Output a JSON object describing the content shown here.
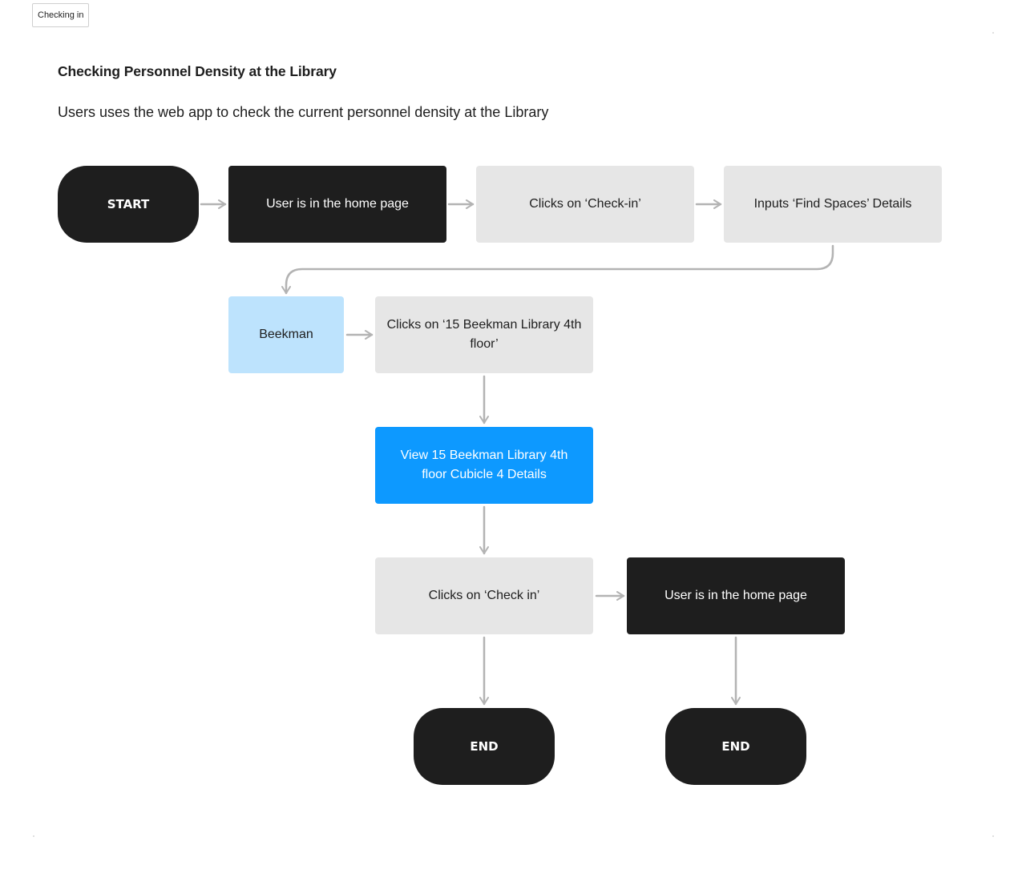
{
  "frame": {
    "label": "Checking in"
  },
  "header": {
    "title": "Checking Personnel Density at the Library",
    "subtitle": "Users uses the web app to check the current personnel density at the Library"
  },
  "colors": {
    "terminal": "#1e1e1e",
    "dark_step": "#1e1e1e",
    "gray_step": "#e6e6e6",
    "light_blue_step": "#bde3fd",
    "blue_step": "#0d99ff",
    "connector": "#b3b3b3"
  },
  "flow": {
    "nodes": [
      {
        "id": "start",
        "label": "START",
        "style": "terminal"
      },
      {
        "id": "home1",
        "label": "User is in the home page",
        "style": "dark"
      },
      {
        "id": "checkin1",
        "label": "Clicks on ‘Check-in’",
        "style": "gray"
      },
      {
        "id": "find",
        "label": "Inputs  ‘Find Spaces’ Details",
        "style": "gray"
      },
      {
        "id": "beekman",
        "label": "Beekman",
        "style": "light-blue"
      },
      {
        "id": "floor",
        "label": "Clicks on ‘15 Beekman Library 4th floor’",
        "style": "gray"
      },
      {
        "id": "view",
        "label": "View 15 Beekman Library 4th floor Cubicle 4 Details",
        "style": "blue"
      },
      {
        "id": "checkin2",
        "label": "Clicks on ‘Check in’",
        "style": "gray"
      },
      {
        "id": "home2",
        "label": "User is in the home page",
        "style": "dark"
      },
      {
        "id": "end1",
        "label": "END",
        "style": "terminal"
      },
      {
        "id": "end2",
        "label": "END",
        "style": "terminal"
      }
    ],
    "edges": [
      {
        "from": "start",
        "to": "home1"
      },
      {
        "from": "home1",
        "to": "checkin1"
      },
      {
        "from": "checkin1",
        "to": "find"
      },
      {
        "from": "find",
        "to": "beekman"
      },
      {
        "from": "beekman",
        "to": "floor"
      },
      {
        "from": "floor",
        "to": "view"
      },
      {
        "from": "view",
        "to": "checkin2"
      },
      {
        "from": "checkin2",
        "to": "home2"
      },
      {
        "from": "checkin2",
        "to": "end1"
      },
      {
        "from": "home2",
        "to": "end2"
      }
    ]
  }
}
